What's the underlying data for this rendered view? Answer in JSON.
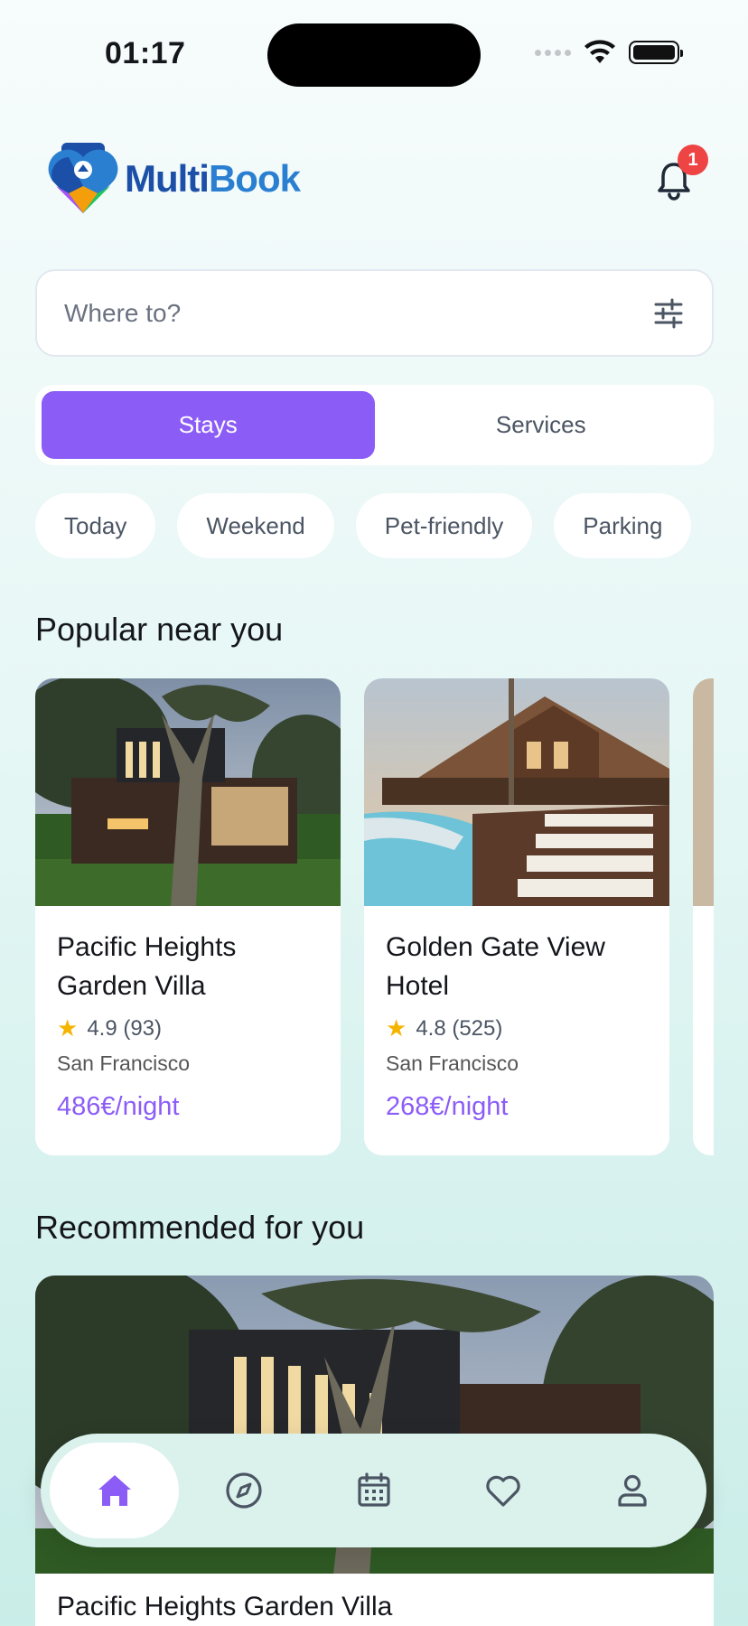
{
  "status_bar": {
    "time": "01:17"
  },
  "header": {
    "logo_part1": "Multi",
    "logo_part2": "Book",
    "notification_count": "1"
  },
  "search": {
    "placeholder": "Where to?"
  },
  "segmented": {
    "tabs": [
      {
        "label": "Stays",
        "active": true
      },
      {
        "label": "Services",
        "active": false
      }
    ]
  },
  "chips": [
    "Today",
    "Weekend",
    "Pet-friendly",
    "Parking"
  ],
  "popular": {
    "title": "Popular near you",
    "items": [
      {
        "name": "Pacific Heights Garden Villa",
        "rating": "4.9 (93)",
        "city": "San Francisco",
        "price": "486€/night"
      },
      {
        "name": "Golden Gate View Hotel",
        "rating": "4.8 (525)",
        "city": "San Francisco",
        "price": "268€/night"
      }
    ]
  },
  "recommended": {
    "title": "Recommended for you",
    "item": {
      "name": "Pacific Heights Garden Villa"
    }
  },
  "nav": {
    "items": [
      {
        "icon": "home-icon",
        "active": true
      },
      {
        "icon": "compass-icon",
        "active": false
      },
      {
        "icon": "calendar-icon",
        "active": false
      },
      {
        "icon": "heart-icon",
        "active": false
      },
      {
        "icon": "user-icon",
        "active": false
      }
    ]
  },
  "colors": {
    "accent": "#8b5cf6",
    "badge": "#ef4444",
    "nav_bg": "#daf1ec",
    "logo_dark": "#1c4fa8",
    "logo_light": "#2a7fd1"
  }
}
